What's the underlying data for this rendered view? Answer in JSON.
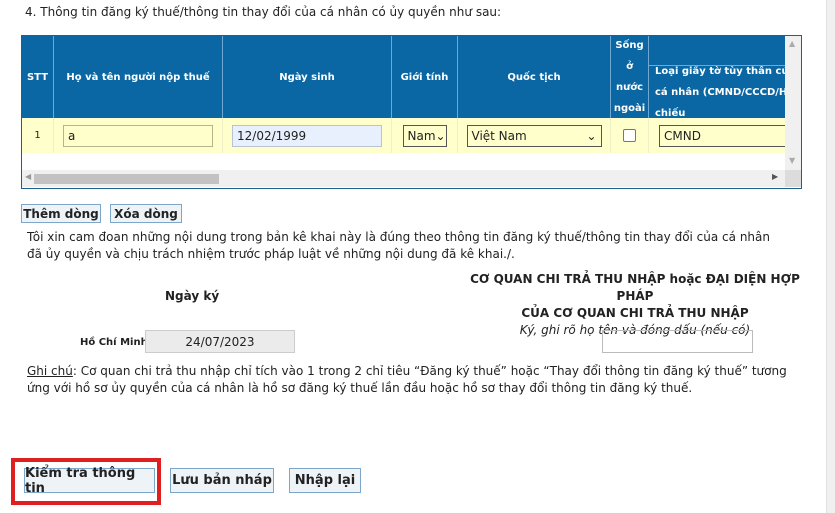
{
  "section_title": "4. Thông tin đăng ký thuế/thông tin thay đổi của cá nhân có ủy quyền như sau:",
  "table": {
    "headers": {
      "stt": "STT",
      "name": "Họ và tên người nộp thuế",
      "dob": "Ngày sinh",
      "gender": "Giới tính",
      "nationality": "Quốc tịch",
      "abroad": "Sống ở nước ngoài",
      "id_type": "Loại giấy tờ tùy thân của cá nhân (CMND/CCCD/Hộ chiếu"
    },
    "rows": [
      {
        "stt": "1",
        "name": "a",
        "dob": "12/02/1999",
        "gender": "Nam",
        "nationality": "Việt Nam",
        "abroad": false,
        "id_type": "CMND"
      }
    ]
  },
  "buttons": {
    "add_row": "Thêm dòng",
    "delete_row": "Xóa dòng",
    "check": "Kiểm tra thông tin",
    "save_draft": "Lưu bản nháp",
    "reset": "Nhập lại"
  },
  "declaration": "Tôi xin cam đoan những nội dung trong bản kê khai này là đúng theo thông tin đăng ký thuế/thông tin thay đổi của cá nhân đã ủy quyền và chịu trách nhiệm trước pháp luật về những nội dung đã kê khai./.",
  "sign": {
    "date_label": "Ngày ký",
    "place": "Hồ Chí Minh,",
    "date": "24/07/2023",
    "agency_line1": "CƠ QUAN CHI TRẢ THU NHẬP hoặc ĐẠI DIỆN HỢP PHÁP",
    "agency_line2": "CỦA CƠ QUAN CHI TRẢ THU NHẬP",
    "agency_note": "Ký, ghi rõ họ tên và đóng dấu (nếu có)",
    "signature_value": ""
  },
  "note": {
    "label": "Ghi chú",
    "text": ": Cơ quan chi trả thu nhập chỉ tích vào 1 trong 2 chỉ tiêu “Đăng ký thuế” hoặc “Thay đổi thông tin đăng ký thuế” tương ứng với hồ sơ ủy quyền của cá nhân là hồ sơ đăng ký thuế lần đầu hoặc hồ sơ thay đổi thông tin đăng ký thuế."
  },
  "colors": {
    "header": "#0a67a3",
    "row": "#ffffcc",
    "highlight": "#e02020"
  }
}
